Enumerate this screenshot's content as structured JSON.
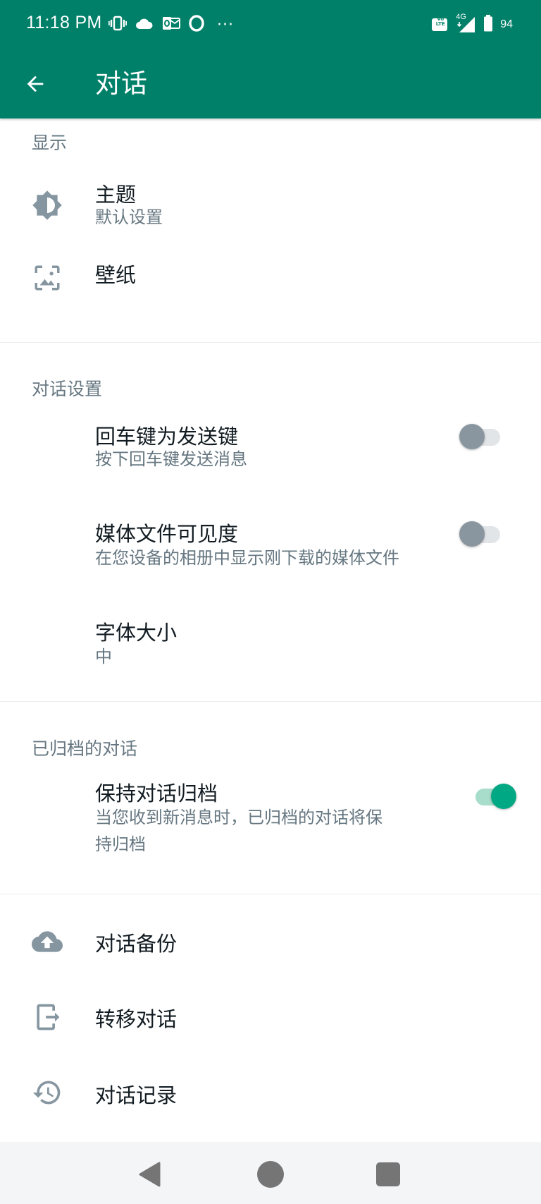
{
  "status_bar": {
    "time": "11:18 PM",
    "more": "···",
    "network": "4G",
    "volte": "Vo LTE",
    "battery": "94"
  },
  "app_bar": {
    "title": "对话"
  },
  "sections": {
    "display": {
      "header": "显示",
      "theme_title": "主题",
      "theme_value": "默认设置",
      "wallpaper_title": "壁纸"
    },
    "chat_settings": {
      "header": "对话设置",
      "enter_send_title": "回车键为发送键",
      "enter_send_sub": "按下回车键发送消息",
      "enter_send_on": false,
      "media_visibility_title": "媒体文件可见度",
      "media_visibility_sub": "在您设备的相册中显示刚下载的媒体文件",
      "media_visibility_on": false,
      "font_size_title": "字体大小",
      "font_size_value": "中"
    },
    "archived": {
      "header": "已归档的对话",
      "keep_archived_title": "保持对话归档",
      "keep_archived_sub_line1": "当您收到新消息时，已归档的对话将保",
      "keep_archived_sub_line2": "持归档",
      "keep_archived_on": true
    },
    "other": {
      "backup_title": "对话备份",
      "transfer_title": "转移对话",
      "history_title": "对话记录"
    }
  },
  "colors": {
    "primary": "#008069",
    "accent": "#00a884",
    "secondary_text": "#667781",
    "icon_gray": "#8696a0"
  }
}
